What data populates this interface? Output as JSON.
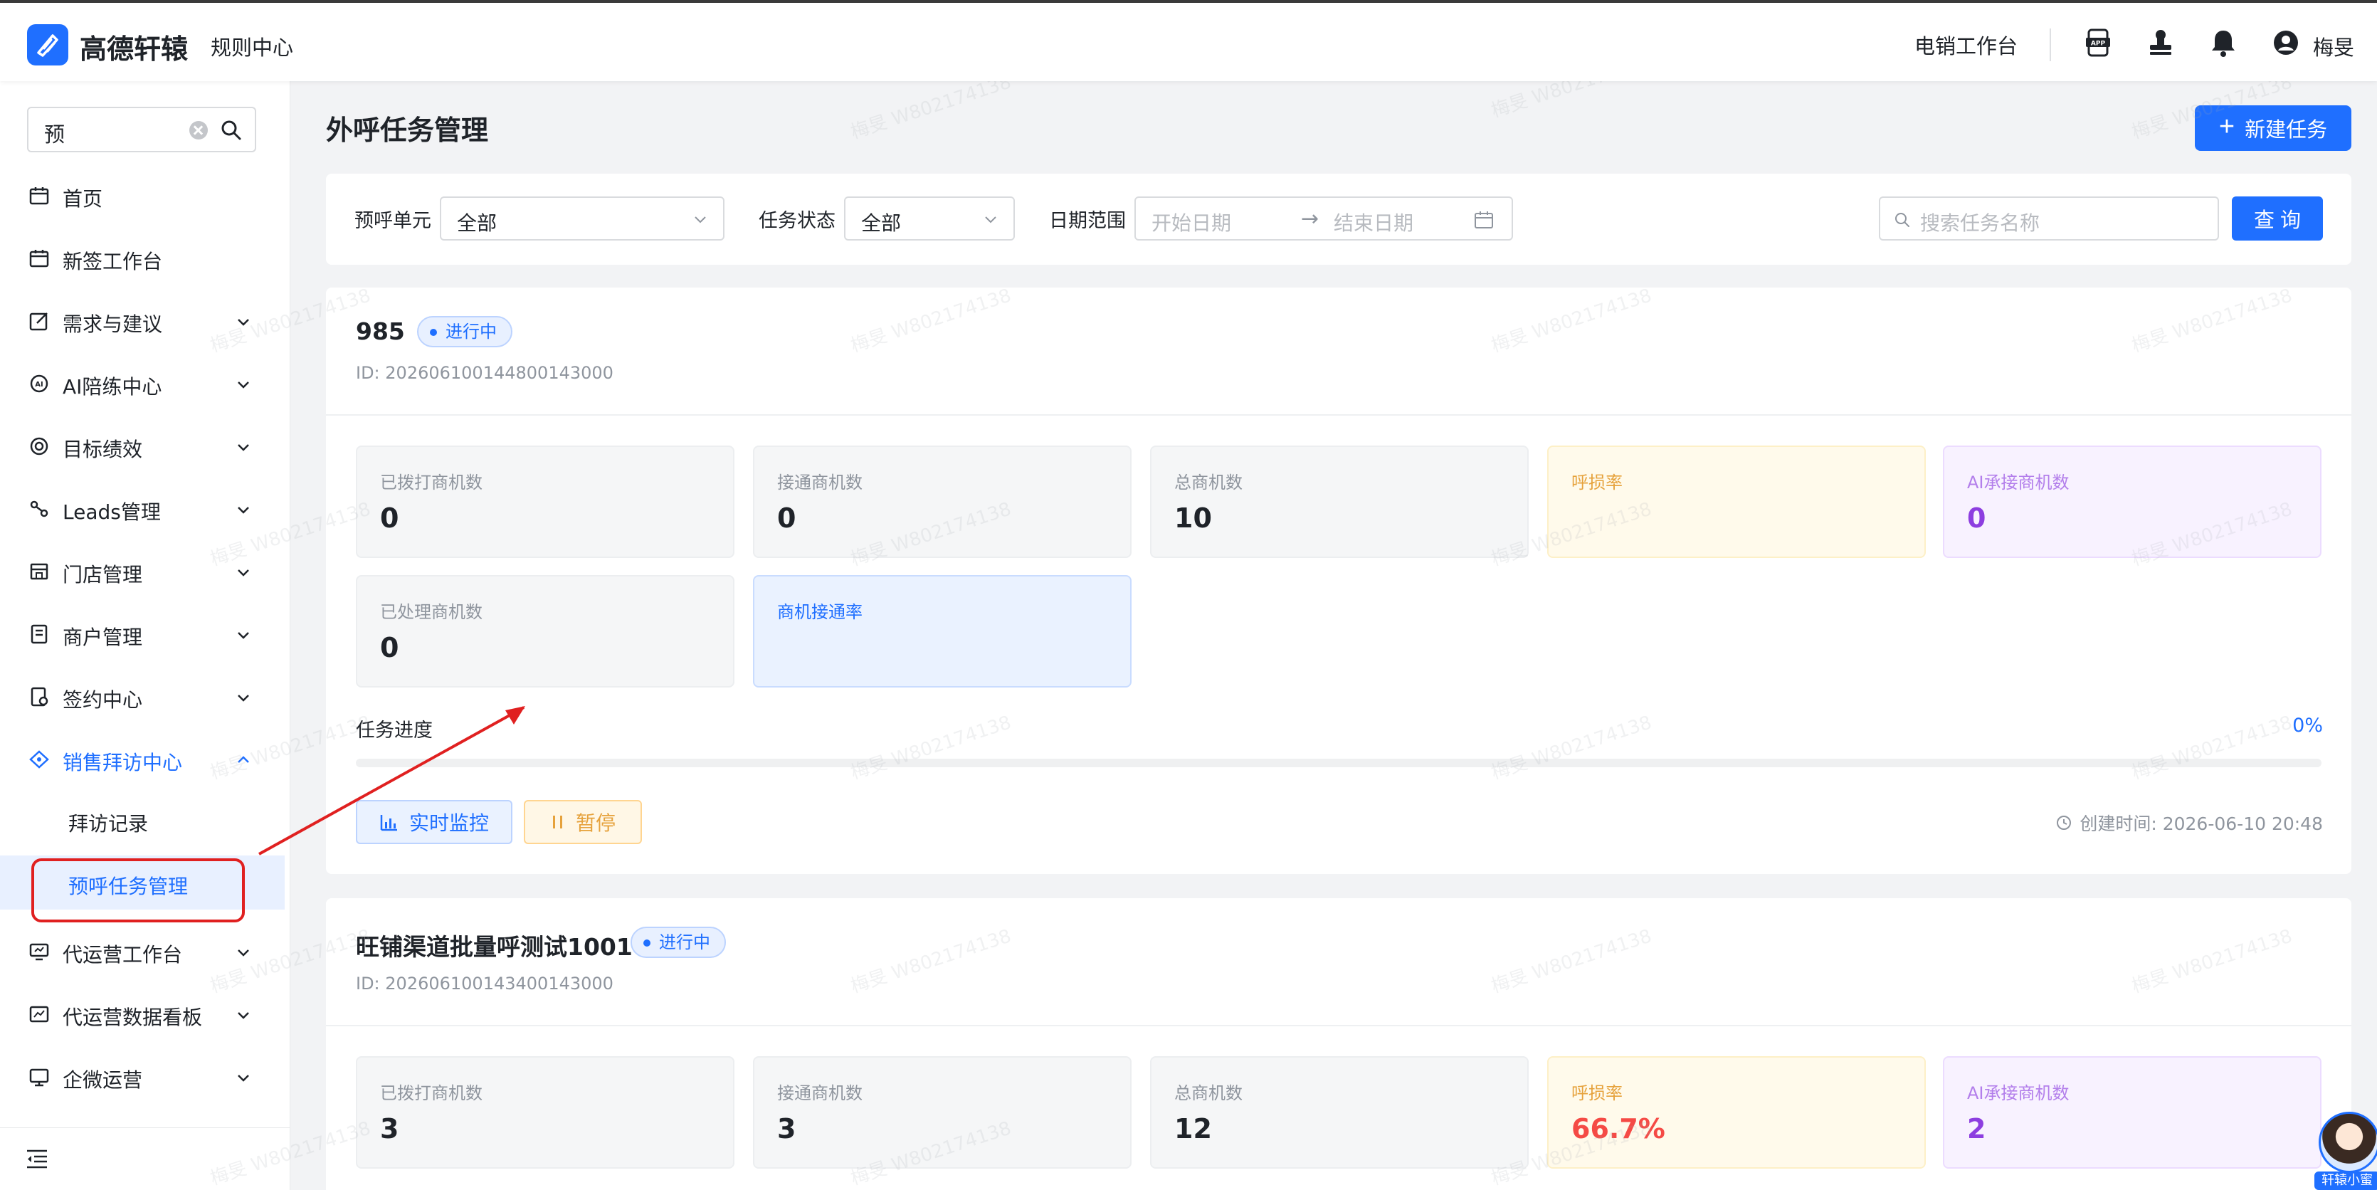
{
  "header": {
    "brand": "高德轩辕",
    "rule_center": "规则中心",
    "workbench": "电销工作台",
    "user_name": "梅旻"
  },
  "sidebar": {
    "search_value": "预",
    "items": [
      {
        "label": "首页",
        "icon": "calendar-icon"
      },
      {
        "label": "新签工作台",
        "icon": "calendar-icon"
      },
      {
        "label": "需求与建议",
        "icon": "edit-icon"
      },
      {
        "label": "AI陪练中心",
        "icon": "ai-chat-icon"
      },
      {
        "label": "目标绩效",
        "icon": "target-icon"
      },
      {
        "label": "Leads管理",
        "icon": "leads-icon"
      },
      {
        "label": "门店管理",
        "icon": "store-icon"
      },
      {
        "label": "商户管理",
        "icon": "merchant-icon"
      },
      {
        "label": "签约中心",
        "icon": "contract-icon"
      },
      {
        "label": "销售拜访中心",
        "icon": "diamond-icon"
      },
      {
        "label": "代运营工作台",
        "icon": "monitor-icon"
      },
      {
        "label": "代运营数据看板",
        "icon": "dashboard-icon"
      },
      {
        "label": "企微运营",
        "icon": "screen-icon"
      }
    ],
    "sub_items": [
      {
        "label": "拜访记录"
      },
      {
        "label": "预呼任务管理"
      }
    ]
  },
  "main": {
    "title": "外呼任务管理",
    "new_task_label": "新建任务",
    "filters": {
      "unit_label": "预呼单元",
      "unit_value": "全部",
      "status_label": "任务状态",
      "status_value": "全部",
      "date_label": "日期范围",
      "start_placeholder": "开始日期",
      "end_placeholder": "结束日期",
      "search_placeholder": "搜索任务名称",
      "query_label": "查询"
    },
    "tasks": [
      {
        "name": "985",
        "status": "进行中",
        "id": "ID: 20260610014480014300​0",
        "stats": [
          {
            "label": "已拨打商机数",
            "value": "0"
          },
          {
            "label": "接通商机数",
            "value": "0"
          },
          {
            "label": "总商机数",
            "value": "10"
          },
          {
            "label": "呼损率",
            "value": ""
          },
          {
            "label": "AI承接商机数",
            "value": "0"
          },
          {
            "label": "已处理商机数",
            "value": "0"
          },
          {
            "label": "商机接通率",
            "value": ""
          }
        ],
        "progress_label": "任务进度",
        "progress_text": "0%",
        "progress_fraction": 0,
        "monitor_label": "实时监控",
        "pause_label": "暂停",
        "created": "创建时间: 2026-06-10 20:48"
      },
      {
        "name": "旺铺渠道批量呼测试1001",
        "status": "进行中",
        "id": "ID: 202606100143400143000",
        "stats": [
          {
            "label": "已拨打商机数",
            "value": "3"
          },
          {
            "label": "接通商机数",
            "value": "3"
          },
          {
            "label": "总商机数",
            "value": "12"
          },
          {
            "label": "呼损率",
            "value": "66.7%"
          },
          {
            "label": "AI承接商机数",
            "value": "2"
          }
        ]
      }
    ]
  },
  "watermark_text": "梅旻 W802174138",
  "assistant_label": "轩辕小蜜",
  "colors": {
    "primary": "#1f6fff",
    "warning_text": "#e6a23c",
    "danger_text": "#f54a45",
    "purple_text": "#8d3ee0",
    "annotation_red": "#e02020"
  }
}
